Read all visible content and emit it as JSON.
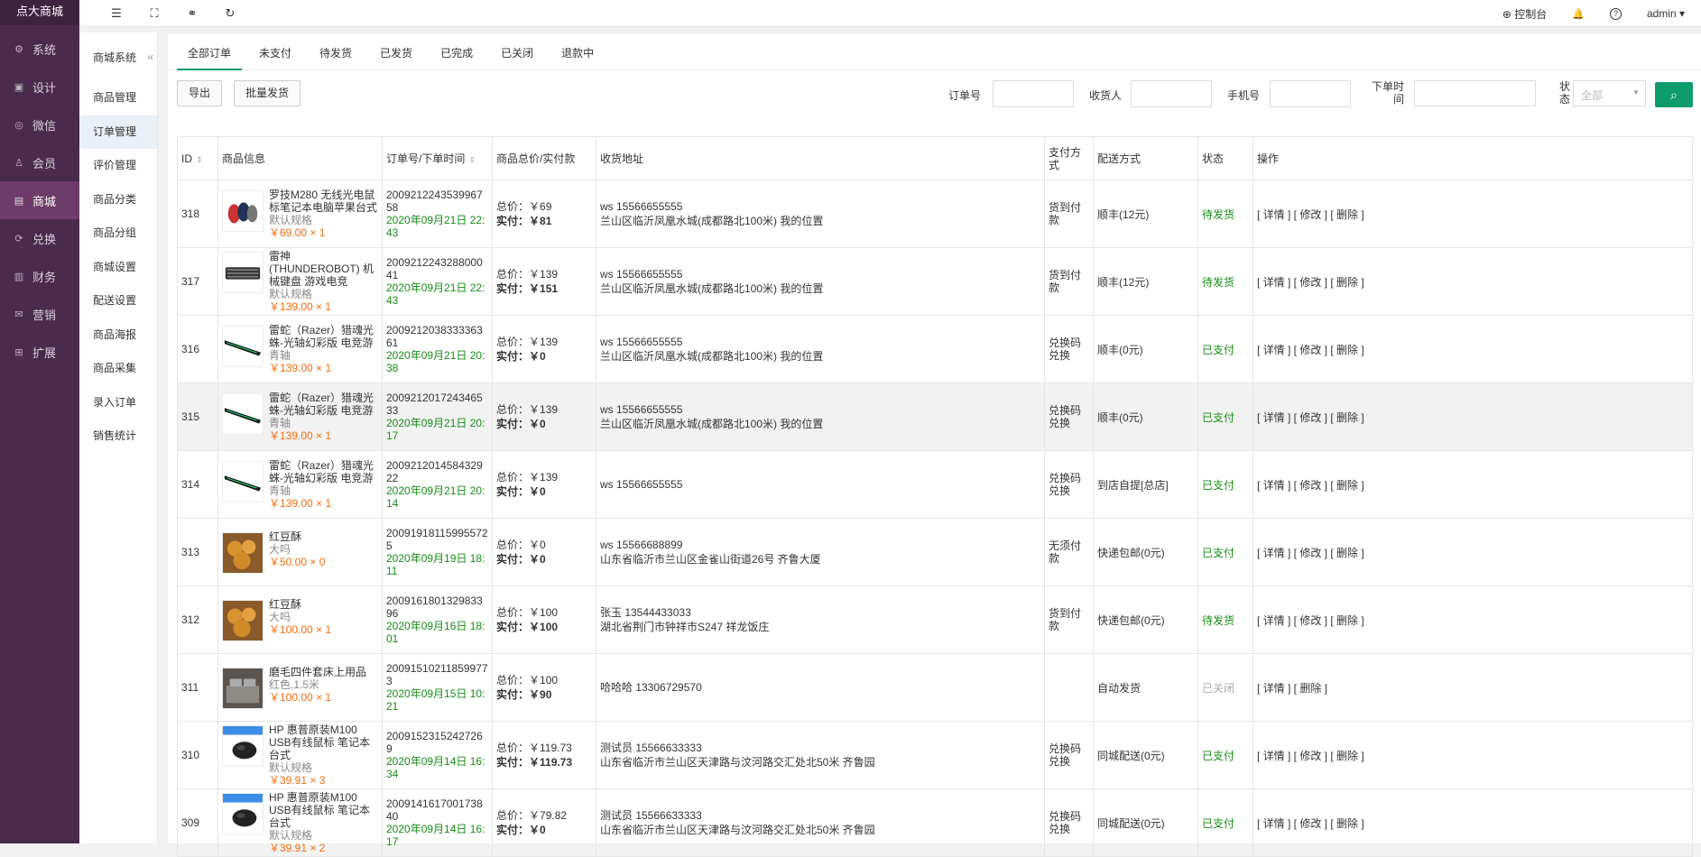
{
  "app": {
    "logo": "点大商城"
  },
  "nav": [
    {
      "label": "系统",
      "icon": "gear-icon",
      "glyph": "⚙"
    },
    {
      "label": "设计",
      "icon": "design-icon",
      "glyph": "▣"
    },
    {
      "label": "微信",
      "icon": "wechat-icon",
      "glyph": "◎"
    },
    {
      "label": "会员",
      "icon": "user-icon",
      "glyph": "♙"
    },
    {
      "label": "商城",
      "icon": "shop-icon",
      "glyph": "▤"
    },
    {
      "label": "兑换",
      "icon": "exchange-icon",
      "glyph": "⟳"
    },
    {
      "label": "财务",
      "icon": "finance-icon",
      "glyph": "▥"
    },
    {
      "label": "营销",
      "icon": "marketing-icon",
      "glyph": "✉"
    },
    {
      "label": "扩展",
      "icon": "extend-icon",
      "glyph": "⊞"
    }
  ],
  "subnav": {
    "title": "商城系统",
    "collapse": "«",
    "items": [
      "商品管理",
      "订单管理",
      "评价管理",
      "商品分类",
      "商品分组",
      "商城设置",
      "配送设置",
      "商品海报",
      "商品采集",
      "录入订单",
      "销售统计"
    ]
  },
  "topbar": {
    "menu_icon": "☰",
    "fullscreen_icon": "⛶",
    "link_icon": "⚭",
    "refresh_icon": "↻",
    "console": "⊕ 控制台",
    "bell": "🔔",
    "help": "?",
    "user": "admin ▾"
  },
  "tabs": [
    "全部订单",
    "未支付",
    "待发货",
    "已发货",
    "已完成",
    "已关闭",
    "退款中"
  ],
  "toolbar": {
    "export": "导出",
    "batch_ship": "批量发货",
    "order_no_label": "订单号",
    "receiver_label": "收货人",
    "phone_label": "手机号",
    "time_label_1": "下单时",
    "time_label_2": "间",
    "status_label_1": "状",
    "status_label_2": "态",
    "status_value": "全部",
    "search_icon": "⌕"
  },
  "table": {
    "headers": {
      "id": "ID",
      "product": "商品信息",
      "order": "订单号/下单时间",
      "amount": "商品总价/实付款",
      "address": "收货地址",
      "pay": "支付方式",
      "ship": "配送方式",
      "status": "状态",
      "ops": "操作"
    },
    "total_prefix": "总价：",
    "paid_prefix": "实付：",
    "rows": [
      {
        "id": "318",
        "name": "罗技M280 无线光电鼠标笔记本电脑苹果台式",
        "spec": "默认规格",
        "price": "￥69.00 × 1",
        "order_no": "200921224353996758",
        "time": "2020年09月21日 22:43",
        "total": "￥69",
        "paid": "￥81",
        "who": "ws 15566655555",
        "addr": "兰山区临沂凤凰水城(成都路北100米) 我的位置",
        "pay": "货到付款",
        "ship": "顺丰(12元)",
        "status": "待发货",
        "ops": "[ 详情 ] [ 修改 ] [ 删除 ]",
        "thumb": "mouse"
      },
      {
        "id": "317",
        "name": "雷神(THUNDEROBOT) 机械键盘 游戏电竞",
        "spec": "默认规格",
        "price": "￥139.00 × 1",
        "order_no": "200921224328800041",
        "time": "2020年09月21日 22:43",
        "total": "￥139",
        "paid": "￥151",
        "who": "ws 15566655555",
        "addr": "兰山区临沂凤凰水城(成都路北100米) 我的位置",
        "pay": "货到付款",
        "ship": "顺丰(12元)",
        "status": "待发货",
        "ops": "[ 详情 ] [ 修改 ] [ 删除 ]",
        "thumb": "keyboard"
      },
      {
        "id": "316",
        "name": "雷蛇（Razer）猎魂光蛛-光轴幻彩版 电竞游",
        "spec": "青轴",
        "price": "￥139.00 × 1",
        "order_no": "200921203833336361",
        "time": "2020年09月21日 20:38",
        "total": "￥139",
        "paid": "￥0",
        "who": "ws 15566655555",
        "addr": "兰山区临沂凤凰水城(成都路北100米) 我的位置",
        "pay": "兑换码兑换",
        "ship": "顺丰(0元)",
        "status": "已支付",
        "ops": "[ 详情 ] [ 修改 ] [ 删除 ]",
        "thumb": "razer"
      },
      {
        "id": "315",
        "name": "雷蛇（Razer）猎魂光蛛-光轴幻彩版 电竞游",
        "spec": "青轴",
        "price": "￥139.00 × 1",
        "order_no": "200921201724346533",
        "time": "2020年09月21日 20:17",
        "total": "￥139",
        "paid": "￥0",
        "who": "ws 15566655555",
        "addr": "兰山区临沂凤凰水城(成都路北100米) 我的位置",
        "pay": "兑换码兑换",
        "ship": "顺丰(0元)",
        "status": "已支付",
        "ops": "[ 详情 ] [ 修改 ] [ 删除 ]",
        "thumb": "razer"
      },
      {
        "id": "314",
        "name": "雷蛇（Razer）猎魂光蛛-光轴幻彩版 电竞游",
        "spec": "青轴",
        "price": "￥139.00 × 1",
        "order_no": "200921201458432922",
        "time": "2020年09月21日 20:14",
        "total": "￥139",
        "paid": "￥0",
        "who": "ws 15566655555",
        "addr": "",
        "pay": "兑换码兑换",
        "ship": "到店自提[总店]",
        "status": "已支付",
        "ops": "[ 详情 ] [ 修改 ] [ 删除 ]",
        "thumb": "razer"
      },
      {
        "id": "313",
        "name": "红豆酥",
        "spec": "大吗",
        "price": "￥50.00 × 0",
        "order_no": "200919181159955725",
        "time": "2020年09月19日 18:11",
        "total": "￥0",
        "paid": "￥0",
        "who": "ws 15566688899",
        "addr": "山东省临沂市兰山区金雀山街道26号 齐鲁大厦",
        "pay": "无须付款",
        "ship": "快递包邮(0元)",
        "status": "已支付",
        "ops": "[ 详情 ] [ 修改 ] [ 删除 ]",
        "thumb": "food"
      },
      {
        "id": "312",
        "name": "红豆酥",
        "spec": "大吗",
        "price": "￥100.00 × 1",
        "order_no": "200916180132983396",
        "time": "2020年09月16日 18:01",
        "total": "￥100",
        "paid": "￥100",
        "who": "张玉 13544433033",
        "addr": "湖北省荆门市钟祥市S247 祥龙饭庄",
        "pay": "货到付款",
        "ship": "快递包邮(0元)",
        "status": "待发货",
        "ops": "[ 详情 ] [ 修改 ] [ 删除 ]",
        "thumb": "food"
      },
      {
        "id": "311",
        "name": "磨毛四件套床上用品",
        "spec": "红色,1.5米",
        "price": "￥100.00 × 1",
        "order_no": "200915102118599773",
        "time": "2020年09月15日 10:21",
        "total": "￥100",
        "paid": "￥90",
        "who": "哈哈哈 13306729570",
        "addr": "",
        "pay": "",
        "ship": "自动发货",
        "status": "已关闭",
        "ops": "[ 详情 ] [ 删除 ]",
        "thumb": "bed"
      },
      {
        "id": "310",
        "name": "HP 惠普原装M100 USB有线鼠标 笔记本台式",
        "spec": "默认规格",
        "price": "￥39.91 × 3",
        "order_no": "20091523152427269",
        "time": "2020年09月14日 16:34",
        "total": "￥119.73",
        "paid": "￥119.73",
        "who": "测试员 15566633333",
        "addr": "山东省临沂市兰山区天津路与汶河路交汇处北50米 齐鲁园",
        "pay": "兑换码兑换",
        "ship": "同城配送(0元)",
        "status": "已支付",
        "ops": "[ 详情 ] [ 修改 ] [ 删除 ]",
        "thumb": "hp"
      },
      {
        "id": "309",
        "name": "HP 惠普原装M100 USB有线鼠标 笔记本台式",
        "spec": "默认规格",
        "price": "￥39.91 × 2",
        "order_no": "200914161700173840",
        "time": "2020年09月14日 16:17",
        "total": "￥79.82",
        "paid": "￥0",
        "who": "测试员 15566633333",
        "addr": "山东省临沂市兰山区天津路与汶河路交汇处北50米 齐鲁园",
        "pay": "兑换码兑换",
        "ship": "同城配送(0元)",
        "status": "已支付",
        "ops": "[ 详情 ] [ 修改 ] [ 删除 ]",
        "thumb": "hp"
      }
    ]
  },
  "colors": {
    "sidebar": "#4b2b4d",
    "sidebar_active": "#6e3c6b",
    "accent": "#0f9c6b",
    "price": "#f56c0d",
    "time": "#168c16"
  }
}
